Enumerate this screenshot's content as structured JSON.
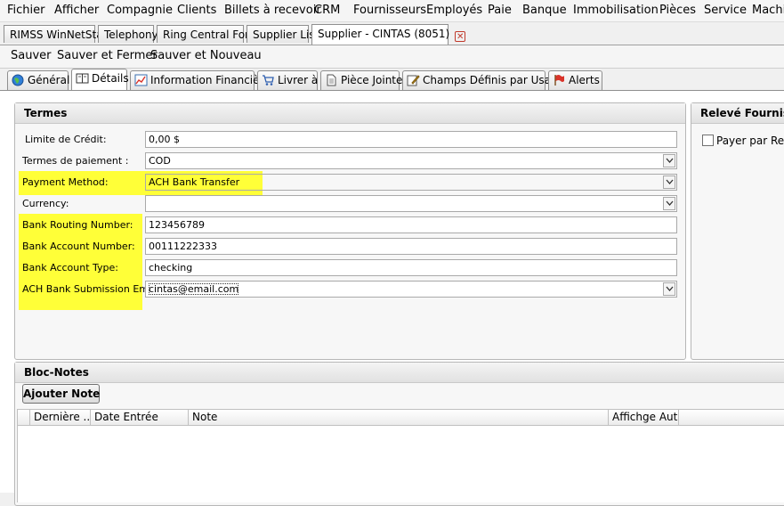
{
  "menu": {
    "items": [
      "Fichier",
      "Afficher",
      "Compagnie",
      "Clients",
      "Billets à recevoir",
      "CRM",
      "Fournisseurs",
      "Employés",
      "Paie",
      "Banque",
      "Immobilisation",
      "Pièces",
      "Service",
      "Machi"
    ]
  },
  "document_tabs": [
    {
      "label": "RIMSS WinNetStar"
    },
    {
      "label": "Telephony"
    },
    {
      "label": "Ring Central Form"
    },
    {
      "label": "Supplier List"
    },
    {
      "label": "Supplier - CINTAS (8051)",
      "active": true
    }
  ],
  "toolbar": {
    "save": "Sauver",
    "save_close": "Sauver et Fermer",
    "save_new": "Sauver et Nouveau"
  },
  "section_tabs": [
    {
      "label": "Général",
      "icon": "globe-icon"
    },
    {
      "label": "Détails",
      "icon": "book-icon",
      "active": true
    },
    {
      "label": "Information Financière",
      "icon": "chart-icon"
    },
    {
      "label": "Livrer à",
      "icon": "cart-icon"
    },
    {
      "label": "Pièce Jointe",
      "icon": "document-icon"
    },
    {
      "label": "Champs Définis par Usager",
      "icon": "edit-icon"
    },
    {
      "label": "Alerts",
      "icon": "flag-icon"
    }
  ],
  "termes": {
    "title": "Termes",
    "fields": [
      {
        "label": "Limite de Crédit:",
        "value": "0,00 $"
      },
      {
        "label": "Termes de paiement :",
        "value": "COD"
      },
      {
        "label": "Payment Method:",
        "value": "ACH Bank Transfer"
      },
      {
        "label": "Currency:",
        "value": ""
      },
      {
        "label": "Bank Routing Number:",
        "value": "123456789"
      },
      {
        "label": "Bank Account Number:",
        "value": "00111222333"
      },
      {
        "label": "Bank Account Type:",
        "value": "checking"
      },
      {
        "label": "ACH Bank Submission Email:",
        "value": "cintas@email.com"
      }
    ]
  },
  "releve": {
    "title": "Relevé Fournisse",
    "checkbox_label": "Payer par Relev"
  },
  "notes": {
    "title": "Bloc-Notes",
    "add_button": "Ajouter Note",
    "columns": [
      "Dernière ...",
      "Date Entrée",
      "Note",
      "Affichge Aut..."
    ]
  },
  "colors": {
    "highlight": "#ffff38",
    "accent": "#f0f0f0"
  }
}
